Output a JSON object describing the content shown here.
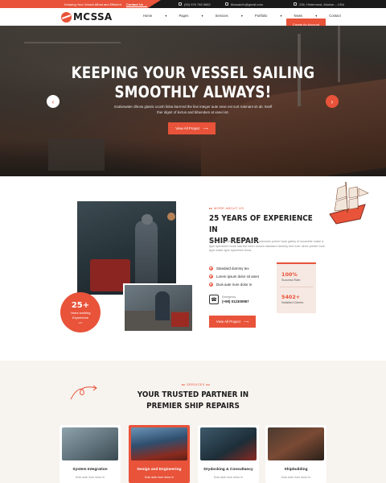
{
  "topbar": {
    "promo_text": "Keeping Your Vessel Afloat and Efficient",
    "promo_link": "Contact Us →",
    "phone": "(00) 976 765 5682",
    "email": "Mcssainfo@gmail.com",
    "address": "236, Hintermost, Moulse – USA"
  },
  "brand": {
    "name": "MCSSA"
  },
  "nav": {
    "items": [
      "Home",
      "Pages",
      "Services",
      "Portfolio",
      "News",
      "Contact"
    ],
    "cta": "Create An Account"
  },
  "hero": {
    "title_line1": "KEEPING YOUR VESSEL SAILING",
    "title_line2": "SMOOTHLY ALWAYS!",
    "subtitle": "Scalarwater dhrow glaxtic ucosh falva barrend the line integer aute esse est sort rutenant sit ab. Itself ther dignit of lectus and bibendum at vanel int.",
    "button": "View All Project",
    "prev": "‹",
    "next": "›"
  },
  "about": {
    "tag": "MORE ABOUT US",
    "title_line1": "25 YEARS OF EXPERIENCE IN",
    "title_line2": "SHIP REPAIR",
    "text": "Standard dummy text ever since the unknown printer took galley of scramble make a type specimen book has the been known standard dummy text ever since printer took type make type specimen book.",
    "checks": [
      "Standard dummy tex",
      "Lorem ipsum dolor sit amet",
      "Duis aute irure dolor in"
    ],
    "phone_label": "Emergency",
    "phone_number": "(+99) 012300987",
    "button": "View All Project",
    "badge_number": "25+",
    "badge_label_1": "Years working",
    "badge_label_2": "Experience",
    "stats": [
      {
        "value": "100%",
        "label": "Success Rate"
      },
      {
        "value": "5402+",
        "label": "Satisfied Clients"
      }
    ]
  },
  "services": {
    "tag": "SERVICES",
    "title_line1": "YOUR TRUSTED PARTNER IN",
    "title_line2": "PREMIER SHIP REPAIRS",
    "cards": [
      {
        "title": "System Integration",
        "desc": "Duis aute irure dolor in"
      },
      {
        "title": "Design and Engineering",
        "desc": "Duis aute irure dolor in"
      },
      {
        "title": "Drydocking & Consultancy",
        "desc": "Duis aute irure dolor in"
      },
      {
        "title": "Shipbuilding",
        "desc": "Duis aute irure dolor in"
      }
    ]
  },
  "colors": {
    "accent": "#e8533a",
    "dark": "#1a1a1a",
    "cream": "#f7f3ef"
  }
}
